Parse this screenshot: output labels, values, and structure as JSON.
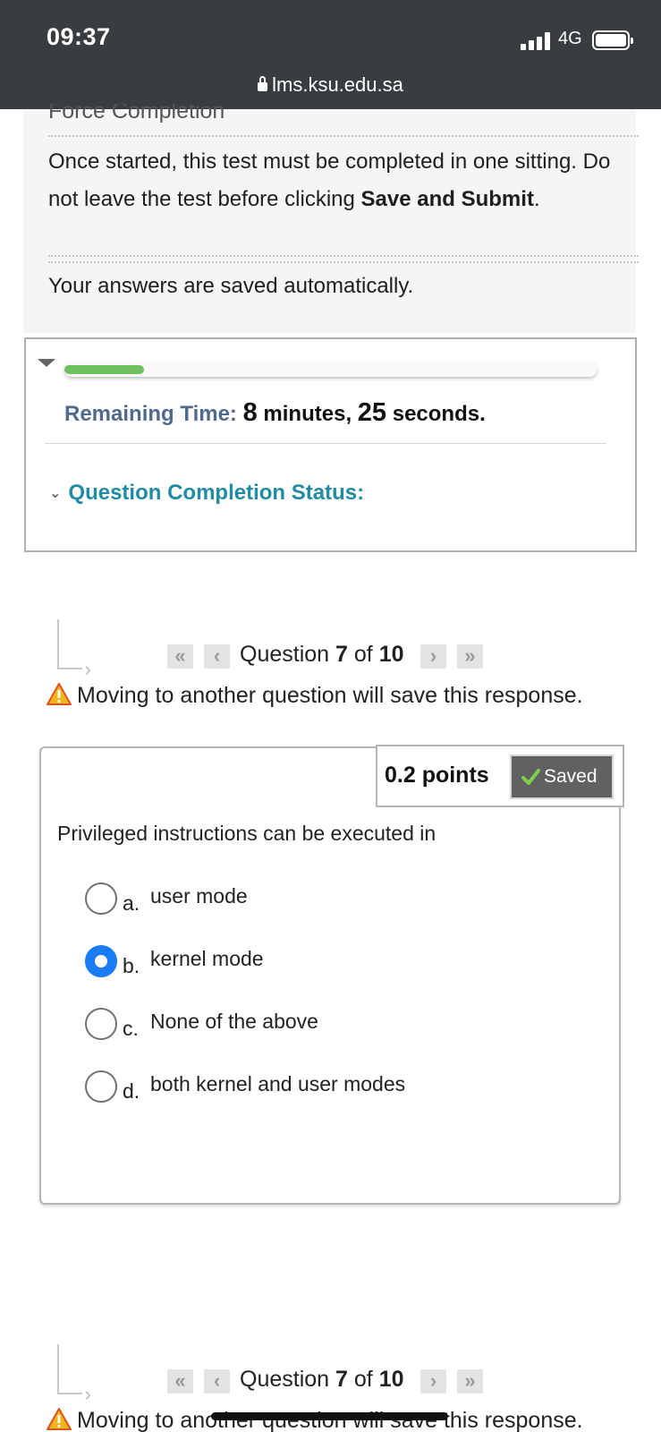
{
  "status_bar": {
    "time": "09:37",
    "network": "4G",
    "url": "lms.ksu.edu.sa"
  },
  "instructions": {
    "title": "Force Completion",
    "text_before": "Once started, this test must be completed in one sitting. Do not leave the test before clicking ",
    "text_bold": "Save and Submit",
    "text_after": ".",
    "auto_save": "Your answers are saved automatically."
  },
  "timer": {
    "progress_fraction": 0.15,
    "label": "Remaining Time:",
    "minutes": "8",
    "minutes_unit": "minutes,",
    "seconds": "25",
    "seconds_unit": "seconds.",
    "completion_status_label": "Question Completion Status:"
  },
  "nav": {
    "question_label": "Question",
    "current": "7",
    "of_label": "of",
    "total": "10",
    "warning": "Moving to another question will save this response."
  },
  "question": {
    "points": "0.2 points",
    "saved_label": "Saved",
    "text": "Privileged instructions can be executed in",
    "options": [
      {
        "letter": "a.",
        "text": "user mode",
        "selected": false
      },
      {
        "letter": "b.",
        "text": "kernel mode",
        "selected": true
      },
      {
        "letter": "c.",
        "text": "None of the above",
        "selected": false
      },
      {
        "letter": "d.",
        "text": "both kernel and user modes",
        "selected": false
      }
    ]
  },
  "colors": {
    "status_bar_bg": "#3a3d40",
    "accent_blue": "#1a7cf5",
    "teal_heading": "#1f8ca3",
    "progress_green": "#6fbf5e"
  }
}
